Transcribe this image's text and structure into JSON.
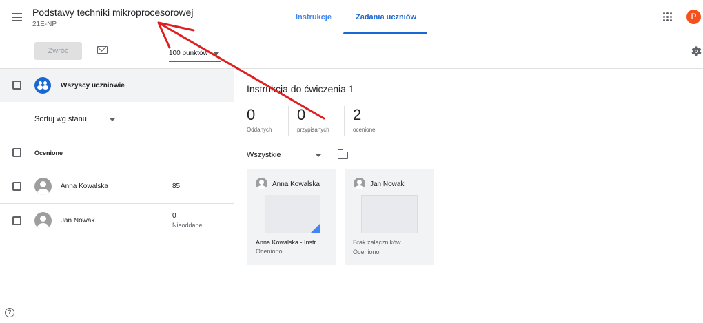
{
  "header": {
    "course_title": "Podstawy techniki mikroprocesorowej",
    "course_section": "21E-NP",
    "tabs": [
      {
        "label": "Instrukcje"
      },
      {
        "label": "Zadania uczniów"
      }
    ],
    "avatar_letter": "P",
    "accent_color": "#1967d2"
  },
  "toolbar": {
    "return_label": "Zwróć",
    "points_value": "100 punktów"
  },
  "left_panel": {
    "all_students_label": "Wszyscy uczniowie",
    "sort_label": "Sortuj wg stanu",
    "section_label": "Ocenione",
    "students": [
      {
        "name": "Anna Kowalska",
        "grade": "85",
        "status": ""
      },
      {
        "name": "Jan Nowak",
        "grade": "0",
        "status": "Nieoddane"
      }
    ]
  },
  "main": {
    "assignment_title": "Instrukcja do ćwiczenia 1",
    "stats": [
      {
        "value": "0",
        "label": "Oddanych"
      },
      {
        "value": "0",
        "label": "przypisanych"
      },
      {
        "value": "2",
        "label": "ocenione"
      }
    ],
    "filter_value": "Wszystkie",
    "cards": [
      {
        "name": "Anna Kowalska",
        "attachment": "Anna Kowalska - Instr...",
        "status": "Oceniono"
      },
      {
        "name": "Jan Nowak",
        "attachment": "Brak załączników",
        "status": "Oceniono"
      }
    ]
  },
  "icons": [
    "menu-icon",
    "apps-icon",
    "mail-icon",
    "settings-icon",
    "group-icon",
    "help-icon",
    "folder-icon",
    "dropdown-caret-icon"
  ],
  "annotation_color": "#e02020"
}
